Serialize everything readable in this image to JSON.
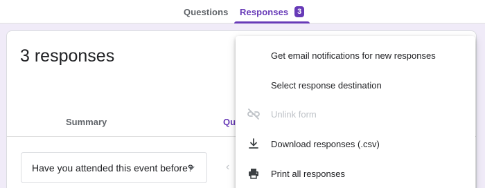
{
  "tabs": {
    "questions": "Questions",
    "responses": "Responses",
    "responses_count": "3"
  },
  "card": {
    "title": "3 responses",
    "subtabs": {
      "summary": "Summary",
      "question": "Qu"
    },
    "question_select": {
      "value": "Have you attended this event before?"
    }
  },
  "menu": {
    "items": [
      {
        "label": "Get email notifications for new responses",
        "icon": "none",
        "enabled": true
      },
      {
        "label": "Select response destination",
        "icon": "none",
        "enabled": true
      },
      {
        "label": "Unlink form",
        "icon": "link-off-icon",
        "enabled": false
      },
      {
        "label": "Download responses (.csv)",
        "icon": "download-icon",
        "enabled": true
      },
      {
        "label": "Print all responses",
        "icon": "printer-icon",
        "enabled": true
      }
    ]
  },
  "colors": {
    "accent": "#673ab7",
    "background": "#f0ebf8",
    "disabled_text": "#bdc1c6"
  }
}
